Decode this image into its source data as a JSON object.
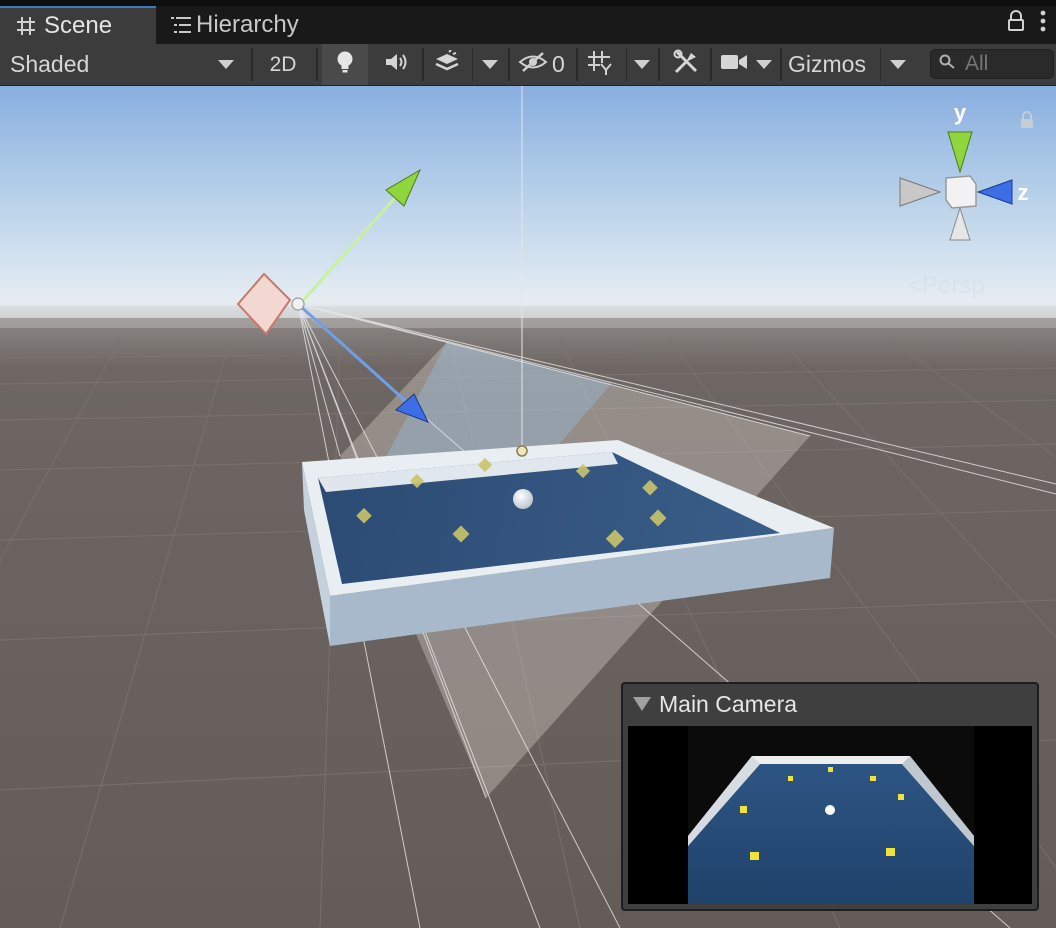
{
  "tabs": [
    {
      "label": "Scene",
      "active": true
    },
    {
      "label": "Hierarchy",
      "active": false
    }
  ],
  "toolbar": {
    "shading_mode": "Shaded",
    "mode_2d": "2D",
    "hidden_count": "0",
    "gizmos": "Gizmos",
    "search_placeholder": "All"
  },
  "viewport": {
    "projection": "Persp",
    "axes": {
      "y": "y",
      "z": "z"
    }
  },
  "camera_preview": {
    "title": "Main Camera"
  },
  "colors": {
    "accent": "#3a79bb",
    "y_axis": "#8fd63d",
    "z_axis": "#3c6ee6",
    "ground": "#6b6460"
  }
}
